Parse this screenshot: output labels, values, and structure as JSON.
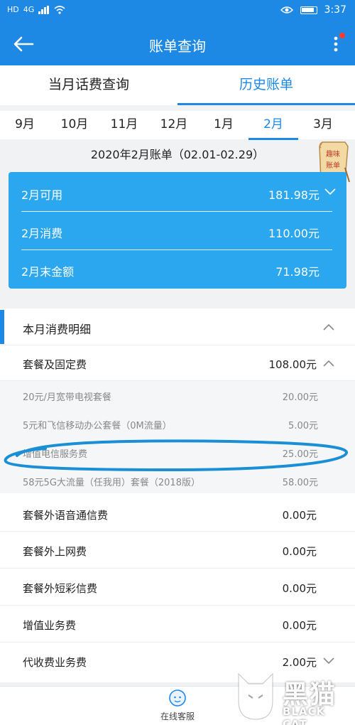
{
  "status_bar": {
    "left_labels": [
      "HD",
      "4G"
    ],
    "time": "3:37"
  },
  "header": {
    "title": "账单查询"
  },
  "main_tabs": [
    {
      "label": "当月话费查询",
      "active": false
    },
    {
      "label": "历史账单",
      "active": true
    }
  ],
  "month_tabs": [
    {
      "label": "9月",
      "active": false
    },
    {
      "label": "10月",
      "active": false
    },
    {
      "label": "11月",
      "active": false
    },
    {
      "label": "12月",
      "active": false
    },
    {
      "label": "1月",
      "active": false
    },
    {
      "label": "2月",
      "active": true
    },
    {
      "label": "3月",
      "active": false
    }
  ],
  "bill_header": "2020年2月账单（02.01-02.29）",
  "fun_badge": "趣味账单",
  "summary": {
    "rows": [
      {
        "label": "2月可用",
        "value": "181.98元"
      },
      {
        "label": "2月消费",
        "value": "110.00元"
      },
      {
        "label": "2月末金额",
        "value": "71.98元"
      }
    ]
  },
  "details": {
    "section_title": "本月消费明细",
    "package": {
      "label": "套餐及固定费",
      "value": "108.00元"
    },
    "package_items": [
      {
        "label": "20元/月宽带电视套餐",
        "value": "20.00元"
      },
      {
        "label": "5元和飞信移动办公套餐（0M流量）",
        "value": "5.00元"
      },
      {
        "label": "增值电信服务费",
        "value": "25.00元"
      },
      {
        "label": "58元5G大流量（任我用）套餐（2018版）",
        "value": "58.00元"
      }
    ],
    "rows": [
      {
        "label": "套餐外语音通信费",
        "value": "0.00元"
      },
      {
        "label": "套餐外上网费",
        "value": "0.00元"
      },
      {
        "label": "套餐外短彩信费",
        "value": "0.00元"
      },
      {
        "label": "增值业务费",
        "value": "0.00元"
      },
      {
        "label": "代收费业务费",
        "value": "2.00元"
      }
    ]
  },
  "bottom_bar": {
    "support_label": "在线客服"
  },
  "watermark": {
    "cn": "黑猫",
    "en": "BLACK CAT"
  },
  "colors": {
    "primary": "#1e88e5",
    "card": "#2aa7ee",
    "annotation": "#1a8fd6"
  }
}
